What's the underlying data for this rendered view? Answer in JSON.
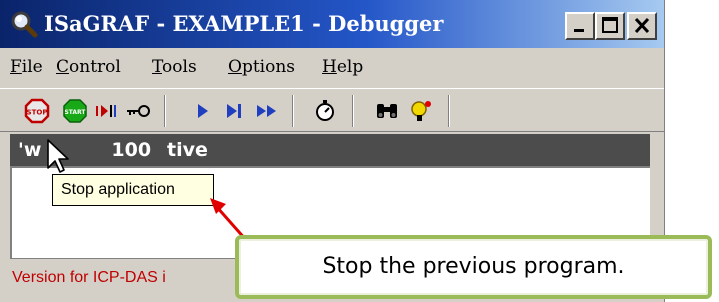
{
  "window": {
    "title": "ISaGRAF - EXAMPLE1 - Debugger",
    "title_icon": "magnifier-icon",
    "controls": [
      "minimize-icon",
      "maximize-icon",
      "close-icon"
    ]
  },
  "menu": {
    "items": [
      {
        "mnemonic": "F",
        "rest": "ile"
      },
      {
        "mnemonic": "C",
        "rest": "ontrol"
      },
      {
        "mnemonic": "T",
        "rest": "ools"
      },
      {
        "mnemonic": "O",
        "rest": "ptions"
      },
      {
        "mnemonic": "H",
        "rest": "elp"
      }
    ]
  },
  "toolbar": {
    "buttons": [
      {
        "icon": "stop-icon",
        "label": "STOP"
      },
      {
        "icon": "start-icon",
        "label": "START"
      },
      {
        "icon": "step-over-icon"
      },
      {
        "icon": "key-icon"
      },
      {
        "icon": "run-icon"
      },
      {
        "icon": "step-icon"
      },
      {
        "icon": "fast-forward-icon"
      },
      {
        "icon": "timer-icon"
      },
      {
        "icon": "binoculars-icon"
      },
      {
        "icon": "spy-light-icon"
      }
    ],
    "tooltip": "Stop application"
  },
  "status_bar_dark": {
    "text_left": "'w",
    "text_mid": "100",
    "text_right": "tive"
  },
  "status": {
    "text": "Version for ICP-DAS i"
  },
  "callout": {
    "text": "Stop the previous program.",
    "border_color": "#9bbb59",
    "arrow_color": "#e00000"
  },
  "colors": {
    "title_bar": "#0a246a",
    "window_face": "#d4d0c8",
    "status_text": "#c00000",
    "tooltip_bg": "#ffffe1"
  }
}
